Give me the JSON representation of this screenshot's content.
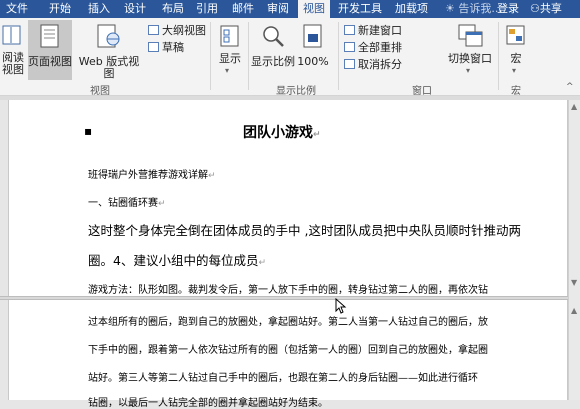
{
  "menubar": {
    "tabs": [
      "文件",
      "开始",
      "插入",
      "设计",
      "布局",
      "引用",
      "邮件",
      "审阅",
      "视图",
      "开发工具",
      "加载项"
    ],
    "active_tab": "视图",
    "tell_me": "告诉我...",
    "sign_in": "登录",
    "share": "共享"
  },
  "ribbon": {
    "views": {
      "read_label": "阅读\n视图",
      "print_layout": "页面视图",
      "web_layout": "Web 版式视图",
      "outline": "大纲视图",
      "draft": "草稿",
      "group_label": "视图"
    },
    "show": {
      "label": "显示"
    },
    "zoom": {
      "zoom_label": "显示比例",
      "percent": "100%",
      "group_label": "显示比例"
    },
    "window": {
      "new_window": "新建窗口",
      "arrange_all": "全部重排",
      "split": "取消拆分",
      "switch_windows": "切换窗口",
      "group_label": "窗口"
    },
    "macros": {
      "label": "宏",
      "group_label": "宏"
    }
  },
  "document": {
    "title": "团队小游戏",
    "para_mark": "↵",
    "line1": "班得瑞户外营推荐游戏详解",
    "line2": "一、钻圈循环赛",
    "line3": "这时整个身体完全倒在团体成员的手中 ,这时团队成员把中央队员顺时针推动两",
    "line4": "圈。4、建议小组中的每位成员",
    "line5": "游戏方法：队形如图。裁判发令后，第一人放下手中的圈，转身钻过第二人的圈，再依次钻",
    "line6": "过本组所有的圈后，跑到自己的放圈处，拿起圈站好。第二人当第一人钻过自己的圈后，放",
    "line7": "下手中的圈，跟着第一人依次钻过所有的圈（包括第一人的圈）回到自己的放圈处，拿起圈",
    "line8": "站好。第三人等第二人钻过自己手中的圈后，也跟在第二人的身后钻圈——如此进行循环",
    "line9": "钻圈，以最后一人钻完全部的圈并拿起圈站好为结束。"
  },
  "colors": {
    "accent": "#2b579a",
    "ribbon_bg": "#f3f3f3"
  }
}
